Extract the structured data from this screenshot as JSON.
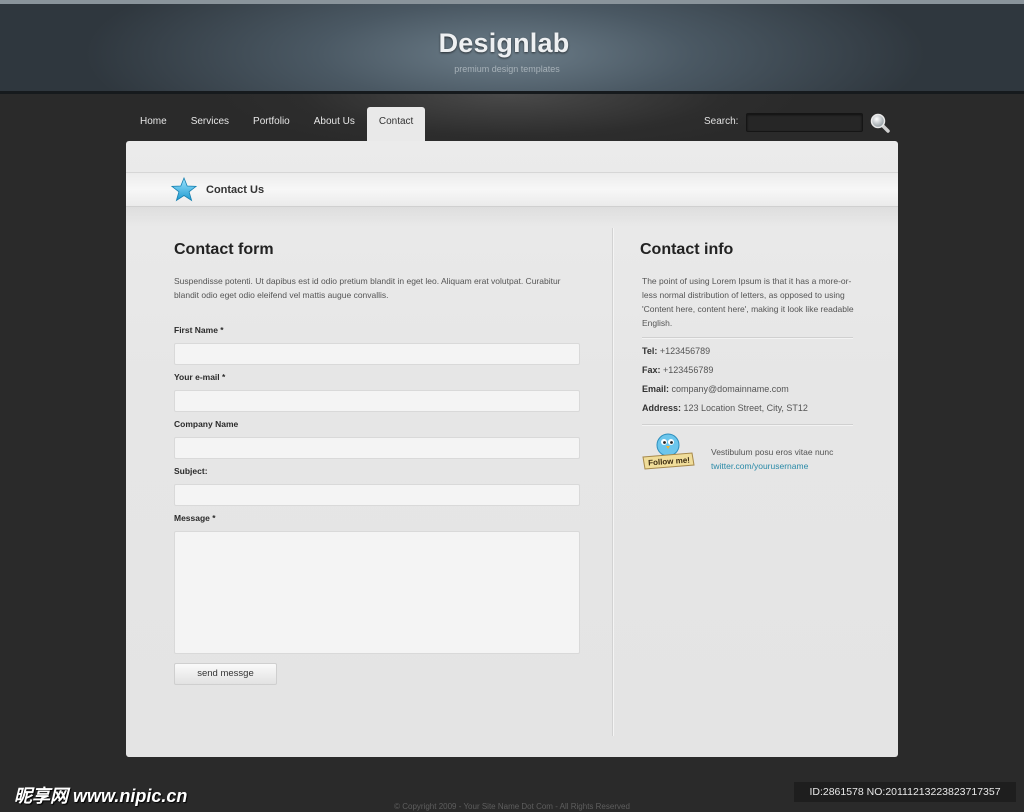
{
  "header": {
    "logo": "Designlab",
    "tagline": "premium design templates"
  },
  "nav": {
    "items": [
      {
        "label": "Home",
        "active": false
      },
      {
        "label": "Services",
        "active": false
      },
      {
        "label": "Portfolio",
        "active": false
      },
      {
        "label": "About Us",
        "active": false
      },
      {
        "label": "Contact",
        "active": true
      }
    ],
    "search_label": "Search:",
    "search_value": ""
  },
  "page": {
    "section_title": "Contact Us"
  },
  "contact_form": {
    "heading": "Contact form",
    "intro": "Suspendisse potenti. Ut dapibus est id odio pretium blandit in eget leo. Aliquam erat volutpat. Curabitur blandit odio eget odio eleifend vel mattis augue convallis.",
    "fields": [
      {
        "label": "First Name *",
        "value": ""
      },
      {
        "label": "Your e-mail *",
        "value": ""
      },
      {
        "label": "Company Name",
        "value": ""
      },
      {
        "label": "Subject:",
        "value": ""
      },
      {
        "label": "Message *",
        "value": ""
      }
    ],
    "submit_label": "send messge"
  },
  "contact_info": {
    "heading": "Contact info",
    "intro": "The point of using Lorem Ipsum is that it has a more-or-less normal distribution of letters, as opposed to using 'Content here, content here', making it look like readable English.",
    "tel_label": "Tel:",
    "tel": "+123456789",
    "fax_label": "Fax:",
    "fax": "+123456789",
    "email_label": "Email:",
    "email": "company@domainname.com",
    "address_label": "Address:",
    "address": "123 Location Street, City, ST12",
    "twitter_text": "Vestibulum posu eros vitae nunc",
    "twitter_link": "twitter.com/yourusername",
    "follow_badge": "Follow me!"
  },
  "footer": {
    "copyright": "© Copyright 2009 - Your Site Name Dot Com - All Rights Reserved"
  },
  "watermark": {
    "left": "昵享网 www.nipic.cn",
    "right": "ID:2861578 NO:20111213223823717357"
  },
  "colors": {
    "accent_link": "#2a8aa8",
    "header_bg": "#4a5863",
    "panel_bg": "#e8e8e8"
  }
}
